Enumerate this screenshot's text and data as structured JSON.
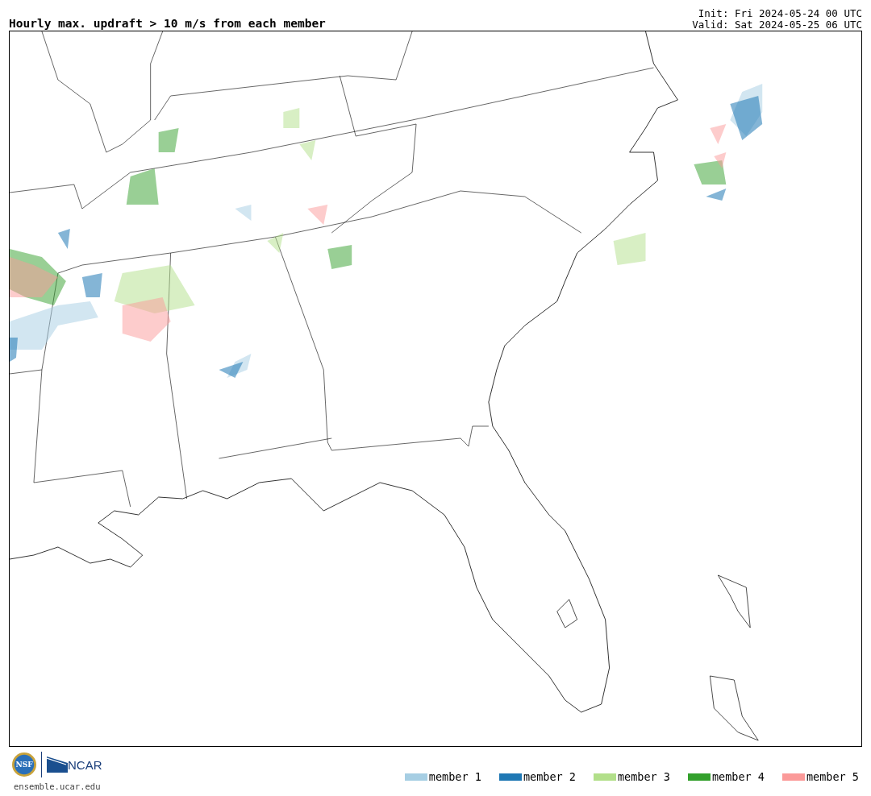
{
  "title": "Hourly max. updraft > 10 m/s from each member",
  "init": "Init: Fri 2024-05-24 00 UTC",
  "valid": "Valid: Sat 2024-05-25 06 UTC",
  "logos": {
    "nsf": "NSF",
    "ncar": "NCAR"
  },
  "url": "ensemble.ucar.edu",
  "legend": [
    {
      "label": "member 1",
      "color": "#a6cee3"
    },
    {
      "label": "member 2",
      "color": "#1f78b4"
    },
    {
      "label": "member 3",
      "color": "#b2df8a"
    },
    {
      "label": "member 4",
      "color": "#33a02c"
    },
    {
      "label": "member 5",
      "color": "#fb9a99"
    }
  ]
}
